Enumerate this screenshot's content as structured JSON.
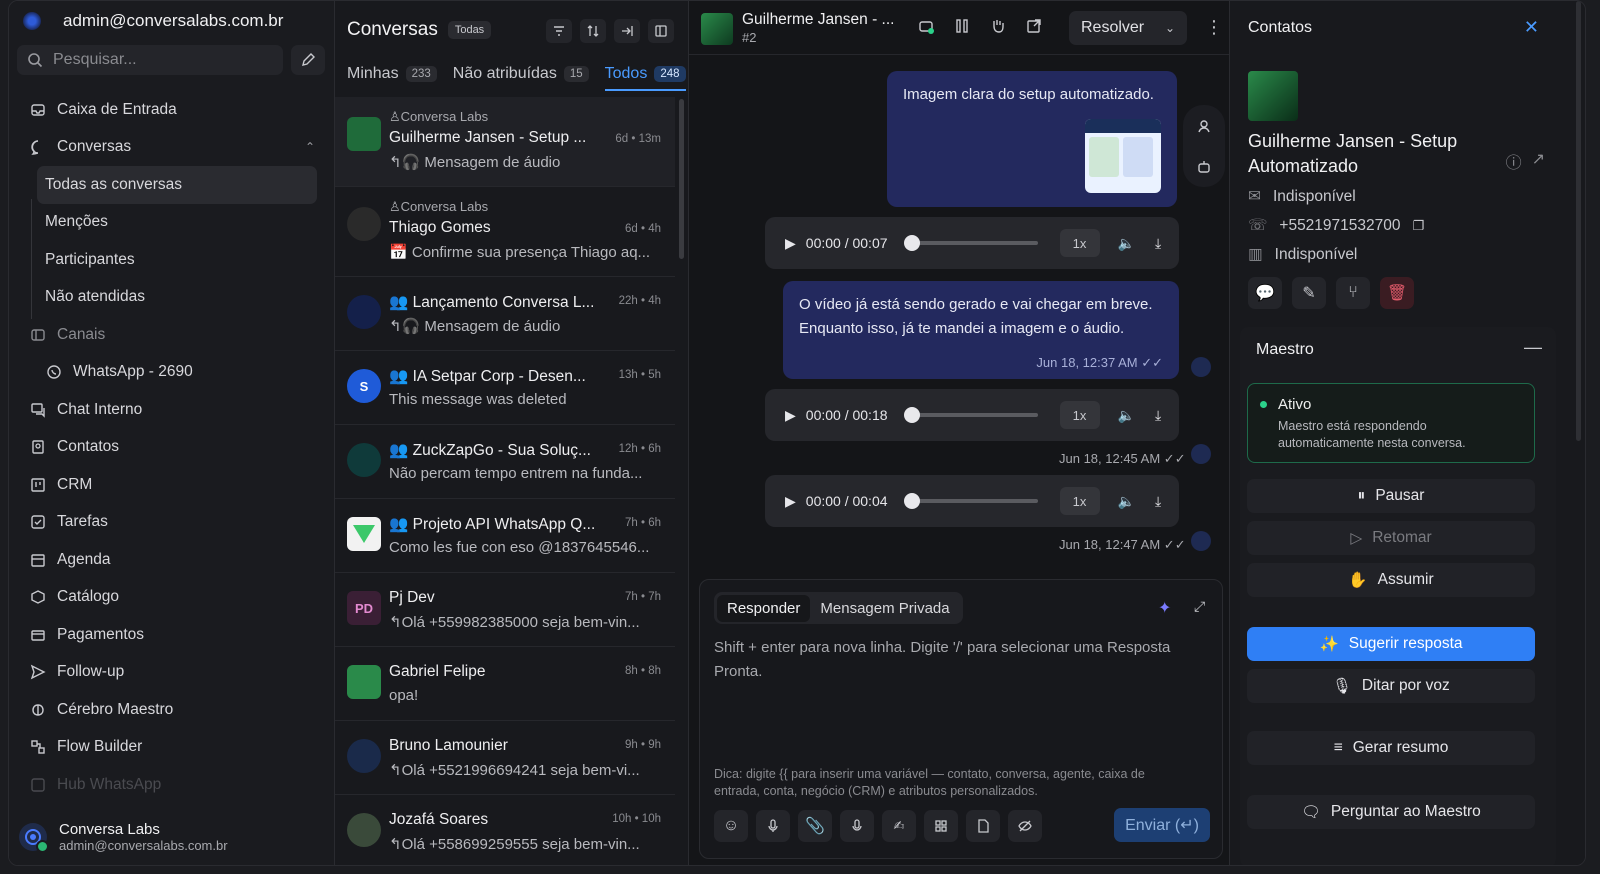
{
  "sidebar": {
    "account_email": "admin@conversalabs.com.br",
    "search_placeholder": "Pesquisar...",
    "items": [
      {
        "label": "Caixa de Entrada"
      },
      {
        "label": "Conversas"
      },
      {
        "label": "Todas as conversas"
      },
      {
        "label": "Menções"
      },
      {
        "label": "Participantes"
      },
      {
        "label": "Não atendidas"
      },
      {
        "label": "Canais"
      },
      {
        "label": "WhatsApp - 2690"
      },
      {
        "label": "Chat Interno"
      },
      {
        "label": "Contatos"
      },
      {
        "label": "CRM"
      },
      {
        "label": "Tarefas"
      },
      {
        "label": "Agenda"
      },
      {
        "label": "Catálogo"
      },
      {
        "label": "Pagamentos"
      },
      {
        "label": "Follow-up"
      },
      {
        "label": "Cérebro Maestro"
      },
      {
        "label": "Flow Builder"
      },
      {
        "label": "Hub WhatsApp"
      }
    ],
    "footer": {
      "name": "Conversa Labs",
      "email": "admin@conversalabs.com.br"
    }
  },
  "conversations": {
    "title": "Conversas",
    "filter_badge": "Todas",
    "tabs": [
      {
        "label": "Minhas",
        "count": "233"
      },
      {
        "label": "Não atribuídas",
        "count": "15"
      },
      {
        "label": "Todos",
        "count": "248"
      }
    ],
    "items": [
      {
        "org": "Conversa Labs",
        "name": "Guilherme Jansen - Setup ...",
        "time": "6d • 13m",
        "message": "Mensagem de áudio",
        "avatar_color": "#1f6b3a"
      },
      {
        "org": "Conversa Labs",
        "name": "Thiago Gomes",
        "time": "6d • 4h",
        "message": "Confirme sua presença Thiago aq...",
        "avatar_color": "#2a2a2a"
      },
      {
        "org": "",
        "name": "Lançamento Conversa L...",
        "time": "22h • 4h",
        "message": "Mensagem de áudio",
        "avatar_color": "#14204a"
      },
      {
        "org": "",
        "name": "IA Setpar Corp - Desen...",
        "time": "13h • 5h",
        "message": "This message was deleted",
        "avatar_color": "#1f5bd8"
      },
      {
        "org": "",
        "name": "ZuckZapGo - Sua Soluç...",
        "time": "12h • 6h",
        "message": "Não percam tempo entrem na funda...",
        "avatar_color": "#0f3a3a"
      },
      {
        "org": "",
        "name": "Projeto API WhatsApp Q...",
        "time": "7h • 6h",
        "message": "Como les fue con eso @1837645546...",
        "avatar_color": "#f2f2f2"
      },
      {
        "org": "",
        "name": "Pj Dev",
        "time": "7h • 7h",
        "message": "Olá +559982385000 seja bem-vin...",
        "avatar_color": "#3a1f35",
        "initials": "PD"
      },
      {
        "org": "",
        "name": "Gabriel Felipe",
        "time": "8h • 8h",
        "message": "opa!",
        "avatar_color": "#2a8a4a"
      },
      {
        "org": "",
        "name": "Bruno Lamounier",
        "time": "9h • 9h",
        "message": "Olá +5521996694241 seja bem-vi...",
        "avatar_color": "#1a2a4a"
      },
      {
        "org": "",
        "name": "Jozafá Soares",
        "time": "10h • 10h",
        "message": "Olá +558699259555 seja bem-vin...",
        "avatar_color": "#3a4a3a"
      }
    ]
  },
  "chat": {
    "contact_name": "Guilherme Jansen - ...",
    "conversation_id": "#2",
    "resolve_label": "Resolver",
    "messages": {
      "image_caption": "Imagem clara do setup automatizado.",
      "audio1": {
        "time": "00:00 / 00:07",
        "speed": "1x"
      },
      "text_msg": "O vídeo já está sendo gerado e vai chegar em breve. Enquanto isso, já te mandei a imagem e o áudio.",
      "text_stamp": "Jun 18, 12:37 AM",
      "audio2": {
        "time": "00:00 / 00:18",
        "speed": "1x",
        "stamp": "Jun 18, 12:45 AM"
      },
      "audio3": {
        "time": "00:00 / 00:04",
        "speed": "1x",
        "stamp": "Jun 18, 12:47 AM"
      }
    },
    "composer": {
      "tab_reply": "Responder",
      "tab_private": "Mensagem Privada",
      "placeholder": "Shift + enter para nova linha. Digite '/' para selecionar uma Resposta Pronta.",
      "hint": "Dica: digite {{ para inserir uma variável — contato, conversa, agente, caixa de entrada, conta, negócio (CRM) e atributos personalizados.",
      "send_label": "Enviar (↵)"
    }
  },
  "contact_panel": {
    "title": "Contatos",
    "name": "Guilherme Jansen - Setup Automatizado",
    "email": "Indisponível",
    "phone": "+5521971532700",
    "company": "Indisponível",
    "maestro": {
      "title": "Maestro",
      "status": "Ativo",
      "status_desc": "Maestro está respondendo automaticamente nesta conversa.",
      "pause": "Pausar",
      "resume": "Retomar",
      "take_over": "Assumir",
      "suggest": "Sugerir resposta",
      "dictate": "Ditar por voz",
      "summary": "Gerar resumo",
      "ask": "Perguntar ao Maestro"
    }
  },
  "colors": {
    "accent": "#2f7ff5",
    "bubble": "#23295e",
    "active_status": "#2bd18a",
    "background": "#16171a"
  }
}
